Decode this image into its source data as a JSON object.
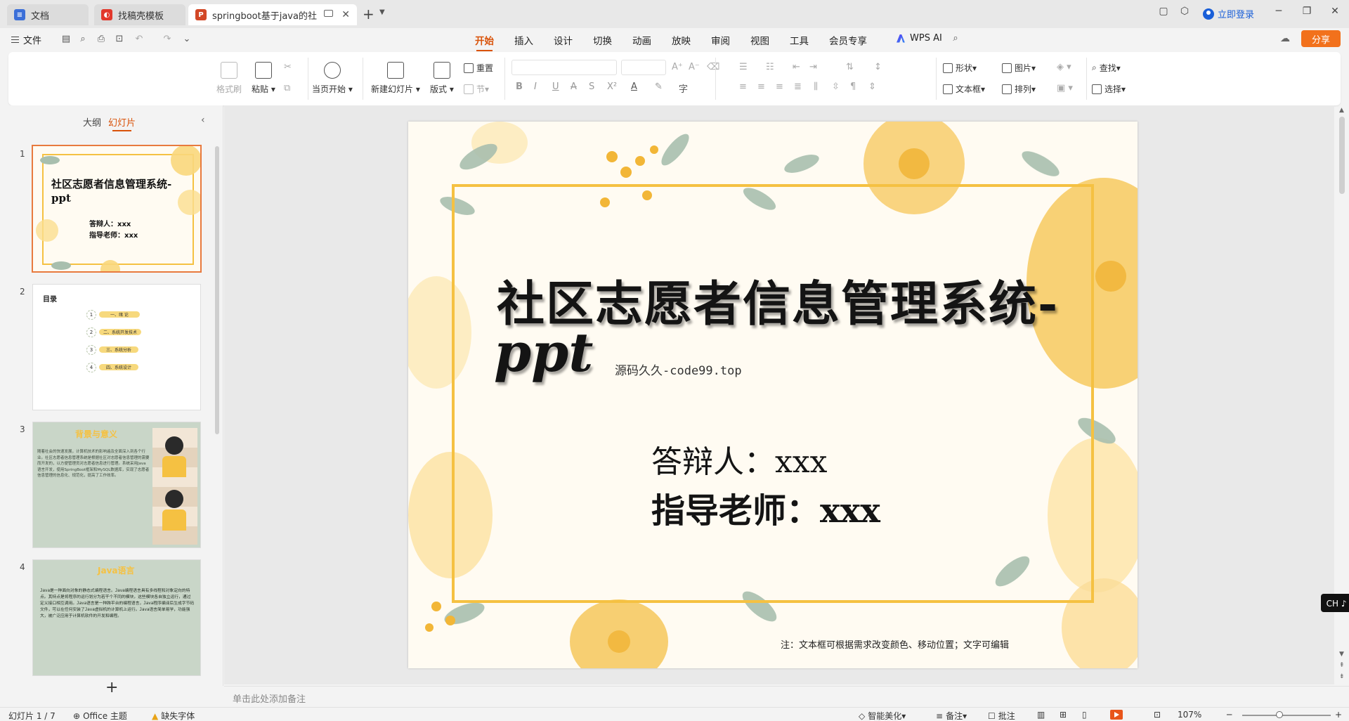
{
  "tabs": [
    {
      "label": "文档",
      "icon": "doc-icon",
      "color": "#3b6fd8"
    },
    {
      "label": "找稿壳模板",
      "icon": "template-icon",
      "color": "#e2382c"
    },
    {
      "label": "springboot基于java的社区志愿者…",
      "icon": "ppt-icon",
      "color": "#d24726",
      "active": true
    }
  ],
  "titlebar": {
    "login": "立即登录"
  },
  "menu": {
    "file": "文件",
    "ribbon_tabs": [
      "开始",
      "插入",
      "设计",
      "切换",
      "动画",
      "放映",
      "审阅",
      "视图",
      "工具",
      "会员专享"
    ],
    "active_tab": "开始",
    "wps_ai": "WPS AI",
    "share": "分享"
  },
  "ribbon": {
    "format_painter": "格式刷",
    "paste": "粘贴",
    "play_from_current": "当页开始",
    "new_slide": "新建幻灯片",
    "layout": "版式",
    "reset": "重置",
    "section": "节",
    "shape": "形状",
    "picture": "图片",
    "textbox": "文本框",
    "arrange": "排列",
    "find": "查找",
    "select": "选择"
  },
  "left_panel": {
    "tab_outline": "大纲",
    "tab_slides": "幻灯片",
    "thumbs": [
      {
        "num": "1",
        "title": "社区志愿者信息管理系统-ppt",
        "line1": "答辩人：xxx",
        "line2": "指导老师：xxx"
      },
      {
        "num": "2",
        "title": "目录",
        "items": [
          "一、绪 论",
          "二、系统开发技术",
          "三、系统分析",
          "四、系统设计"
        ]
      },
      {
        "num": "3",
        "title": "背景与意义",
        "body": "随着社会的快速发展，计算机技术的影响遍及全面深入到各个行业。社区志愿者信息管理系统是根据社区对志愿者信息管理的需要而开发的，以方便管理员对志愿者信息进行管理。系统采用Java语言开发，使用SpringBoot框架和MySQL数据库，实现了志愿者信息管理的信息化、规范化，提高了工作效率。"
      },
      {
        "num": "4",
        "title": "Java语言",
        "body": "Java是一种面向对象的静态式编程语言。Java编程语言具有多线程和对象定向的特点。其特点是将程序的运行划分为若干个不同的模块，这些模块各自独立运行，通过定义接口相互调用。Java语言是一种跨平台的编程语言，Java程序编译后生成字节码文件，可以在任何安装了Java虚拟机的计算机上运行。Java语言简单易学，功能强大，被广泛应用于计算机软件的开发和编程。"
      }
    ]
  },
  "slide": {
    "title": "社区志愿者信息管理系统-",
    "title_ppt": "ppt",
    "source": "源码久久-code99.top",
    "defender": "答辩人：xxx",
    "advisor": "指导老师：xxx",
    "note": "注：文本框可根据需求改变颜色、移动位置；文字可编辑"
  },
  "notes_placeholder": "单击此处添加备注",
  "status": {
    "slide_count": "幻灯片 1 / 7",
    "theme": "Office 主题",
    "missing_font": "缺失字体",
    "smart_beautify": "智能美化",
    "notes": "备注",
    "comments": "批注",
    "zoom": "107%"
  },
  "ime": "CH ♪ 简",
  "colors": {
    "accent": "#d9530a",
    "share": "#f2711c",
    "frame": "#f5c142"
  }
}
